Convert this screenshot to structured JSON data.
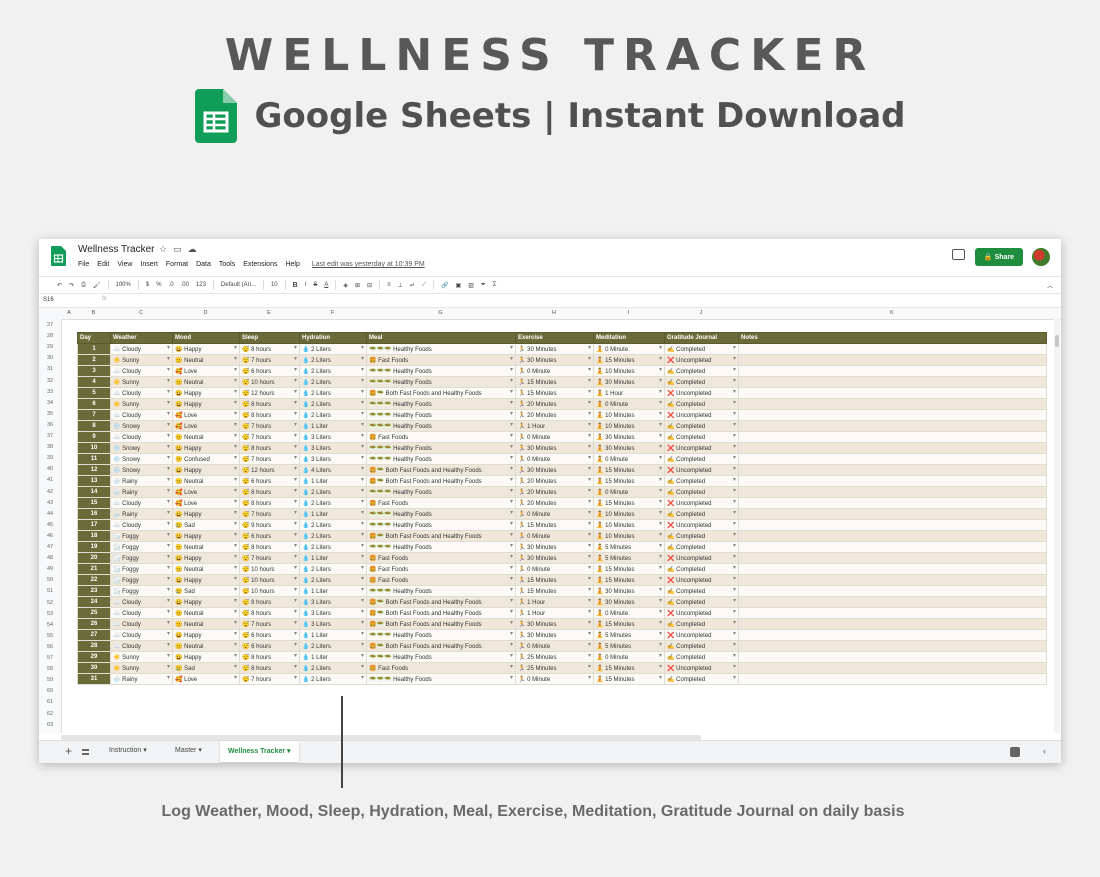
{
  "hero": {
    "title": "WELLNESS TRACKER",
    "subtitle": "Google Sheets | Instant Download"
  },
  "window": {
    "doc_title": "Wellness Tracker",
    "menu": [
      "File",
      "Edit",
      "View",
      "Insert",
      "Format",
      "Data",
      "Tools",
      "Extensions",
      "Help"
    ],
    "last_edit": "Last edit was yesterday at 10:39 PM",
    "share_label": "Share",
    "zoom": "100%",
    "font": "Default (Ari...",
    "font_size": "10",
    "cell_ref": "S16",
    "fx": "fx",
    "format_labels": [
      "$",
      "%",
      ".0",
      ".00",
      "123"
    ]
  },
  "column_letters": [
    "A",
    "B",
    "C",
    "D",
    "E",
    "F",
    "G",
    "H",
    "I",
    "J",
    "K"
  ],
  "row_numbers": [
    "27",
    "28",
    "29",
    "30",
    "31",
    "32",
    "33",
    "34",
    "35",
    "36",
    "37",
    "38",
    "39",
    "40",
    "41",
    "42",
    "43",
    "44",
    "45",
    "46",
    "47",
    "48",
    "49",
    "50",
    "51",
    "52",
    "53",
    "54",
    "55",
    "56",
    "57",
    "58",
    "59",
    "60",
    "61",
    "62",
    "63"
  ],
  "table": {
    "headers": [
      "Day",
      "Weather",
      "Mood",
      "Sleep",
      "Hydration",
      "Meal",
      "Exercise",
      "Meditation",
      "Gratitude Journal",
      "Notes"
    ],
    "rows": [
      [
        "1",
        "☁️ Cloudy",
        "😀 Happy",
        "😴 8 hours",
        "💧 2 Liters",
        "🥗🥗🥗 Healthy Foods",
        "🏃 30 Minutes",
        "🧘 0 Minute",
        "✍️ Completed"
      ],
      [
        "2",
        "☀️ Sunny",
        "😐 Neutral",
        "😴 7 hours",
        "💧 2 Liters",
        "🍔 Fast Foods",
        "🏃 30 Minutes",
        "🧘 15 Minutes",
        "❌ Uncompleted"
      ],
      [
        "3",
        "☁️ Cloudy",
        "🥰 Love",
        "😴 6 hours",
        "💧 2 Liters",
        "🥗🥗🥗 Healthy Foods",
        "🏃 0 Minute",
        "🧘 10 Minutes",
        "✍️ Completed"
      ],
      [
        "4",
        "☀️ Sunny",
        "😐 Neutral",
        "😴 10 hours",
        "💧 2 Liters",
        "🥗🥗🥗 Healthy Foods",
        "🏃 15 Minutes",
        "🧘 30 Minutes",
        "✍️ Completed"
      ],
      [
        "5",
        "☁️ Cloudy",
        "😀 Happy",
        "😴 12 hours",
        "💧 2 Liters",
        "🍔🥗 Both Fast Foods and Healthy Foods",
        "🏃 15 Minutes",
        "🧘 1 Hour",
        "❌ Uncompleted"
      ],
      [
        "6",
        "☀️ Sunny",
        "😀 Happy",
        "😴 8 hours",
        "💧 2 Liters",
        "🥗🥗🥗 Healthy Foods",
        "🏃 20 Minutes",
        "🧘 0 Minute",
        "✍️ Completed"
      ],
      [
        "7",
        "☁️ Cloudy",
        "🥰 Love",
        "😴 8 hours",
        "💧 2 Liters",
        "🥗🥗🥗 Healthy Foods",
        "🏃 20 Minutes",
        "🧘 10 Minutes",
        "❌ Uncompleted"
      ],
      [
        "8",
        "❄️ Snowy",
        "🥰 Love",
        "😴 7 hours",
        "💧 1 Liter",
        "🥗🥗🥗 Healthy Foods",
        "🏃 1 Hour",
        "🧘 10 Minutes",
        "✍️ Completed"
      ],
      [
        "9",
        "☁️ Cloudy",
        "😐 Neutral",
        "😴 7 hours",
        "💧 3 Liters",
        "🍔 Fast Foods",
        "🏃 0 Minute",
        "🧘 30 Minutes",
        "✍️ Completed"
      ],
      [
        "10",
        "❄️ Snowy",
        "😀 Happy",
        "😴 8 hours",
        "💧 3 Liters",
        "🥗🥗🥗 Healthy Foods",
        "🏃 30 Minutes",
        "🧘 30 Minutes",
        "❌ Uncompleted"
      ],
      [
        "11",
        "❄️ Snowy",
        "😕 Confused",
        "😴 7 hours",
        "💧 3 Liters",
        "🥗🥗🥗 Healthy Foods",
        "🏃 0 Minute",
        "🧘 0 Minute",
        "✍️ Completed"
      ],
      [
        "12",
        "❄️ Snowy",
        "😀 Happy",
        "😴 12 hours",
        "💧 4 Liters",
        "🍔🥗 Both Fast Foods and Healthy Foods",
        "🏃 30 Minutes",
        "🧘 15 Minutes",
        "❌ Uncompleted"
      ],
      [
        "13",
        "🌧️ Rainy",
        "😐 Neutral",
        "😴 6 hours",
        "💧 1 Liter",
        "🍔🥗 Both Fast Foods and Healthy Foods",
        "🏃 20 Minutes",
        "🧘 15 Minutes",
        "✍️ Completed"
      ],
      [
        "14",
        "🌧️ Rainy",
        "🥰 Love",
        "😴 8 hours",
        "💧 2 Liters",
        "🥗🥗🥗 Healthy Foods",
        "🏃 20 Minutes",
        "🧘 0 Minute",
        "✍️ Completed"
      ],
      [
        "15",
        "☁️ Cloudy",
        "🥰 Love",
        "😴 8 hours",
        "💧 2 Liters",
        "🍔 Fast Foods",
        "🏃 20 Minutes",
        "🧘 15 Minutes",
        "❌ Uncompleted"
      ],
      [
        "16",
        "🌧️ Rainy",
        "😀 Happy",
        "😴 7 hours",
        "💧 1 Liter",
        "🥗🥗🥗 Healthy Foods",
        "🏃 0 Minute",
        "🧘 10 Minutes",
        "✍️ Completed"
      ],
      [
        "17",
        "☁️ Cloudy",
        "😢 Sad",
        "😴 9 hours",
        "💧 2 Liters",
        "🥗🥗🥗 Healthy Foods",
        "🏃 15 Minutes",
        "🧘 10 Minutes",
        "❌ Uncompleted"
      ],
      [
        "18",
        "🌫️ Foggy",
        "😀 Happy",
        "😴 6 hours",
        "💧 2 Liters",
        "🍔🥗 Both Fast Foods and Healthy Foods",
        "🏃 0 Minute",
        "🧘 10 Minutes",
        "✍️ Completed"
      ],
      [
        "19",
        "🌫️ Foggy",
        "😐 Neutral",
        "😴 8 hours",
        "💧 2 Liters",
        "🥗🥗🥗 Healthy Foods",
        "🏃 30 Minutes",
        "🧘 5 Minutes",
        "✍️ Completed"
      ],
      [
        "20",
        "🌫️ Foggy",
        "😀 Happy",
        "😴 7 hours",
        "💧 1 Liter",
        "🍔 Fast Foods",
        "🏃 30 Minutes",
        "🧘 5 Minutes",
        "❌ Uncompleted"
      ],
      [
        "21",
        "🌫️ Foggy",
        "😐 Neutral",
        "😴 10 hours",
        "💧 2 Liters",
        "🍔 Fast Foods",
        "🏃 0 Minute",
        "🧘 15 Minutes",
        "✍️ Completed"
      ],
      [
        "22",
        "🌫️ Foggy",
        "😀 Happy",
        "😴 10 hours",
        "💧 2 Liters",
        "🍔 Fast Foods",
        "🏃 15 Minutes",
        "🧘 15 Minutes",
        "❌ Uncompleted"
      ],
      [
        "23",
        "🌫️ Foggy",
        "😢 Sad",
        "😴 10 hours",
        "💧 1 Liter",
        "🥗🥗🥗 Healthy Foods",
        "🏃 15 Minutes",
        "🧘 30 Minutes",
        "✍️ Completed"
      ],
      [
        "24",
        "☁️ Cloudy",
        "😀 Happy",
        "😴 8 hours",
        "💧 3 Liters",
        "🍔🥗 Both Fast Foods and Healthy Foods",
        "🏃 1 Hour",
        "🧘 30 Minutes",
        "✍️ Completed"
      ],
      [
        "25",
        "☁️ Cloudy",
        "😐 Neutral",
        "😴 8 hours",
        "💧 3 Liters",
        "🍔🥗 Both Fast Foods and Healthy Foods",
        "🏃 1 Hour",
        "🧘 0 Minute",
        "❌ Uncompleted"
      ],
      [
        "26",
        "☁️ Cloudy",
        "😐 Neutral",
        "😴 7 hours",
        "💧 3 Liters",
        "🍔🥗 Both Fast Foods and Healthy Foods",
        "🏃 30 Minutes",
        "🧘 15 Minutes",
        "✍️ Completed"
      ],
      [
        "27",
        "☁️ Cloudy",
        "😀 Happy",
        "😴 6 hours",
        "💧 1 Liter",
        "🥗🥗🥗 Healthy Foods",
        "🏃 30 Minutes",
        "🧘 5 Minutes",
        "❌ Uncompleted"
      ],
      [
        "28",
        "☁️ Cloudy",
        "😐 Neutral",
        "😴 6 hours",
        "💧 2 Liters",
        "🍔🥗 Both Fast Foods and Healthy Foods",
        "🏃 0 Minute",
        "🧘 5 Minutes",
        "✍️ Completed"
      ],
      [
        "29",
        "☀️ Sunny",
        "😀 Happy",
        "😴 8 hours",
        "💧 1 Liter",
        "🥗🥗🥗 Healthy Foods",
        "🏃 25 Minutes",
        "🧘 0 Minute",
        "✍️ Completed"
      ],
      [
        "30",
        "☀️ Sunny",
        "😢 Sad",
        "😴 8 hours",
        "💧 2 Liters",
        "🍔 Fast Foods",
        "🏃 25 Minutes",
        "🧘 15 Minutes",
        "❌ Uncompleted"
      ],
      [
        "31",
        "🌧️ Rainy",
        "🥰 Love",
        "😴 7 hours",
        "💧 2 Liters",
        "🥗🥗🥗 Healthy Foods",
        "🏃 0 Minute",
        "🧘 15 Minutes",
        "✍️ Completed"
      ]
    ]
  },
  "tabs": [
    "Instruction",
    "Master",
    "Wellness Tracker"
  ],
  "active_tab": "Wellness Tracker",
  "caption": "Log Weather, Mood, Sleep, Hydration, Meal, Exercise, Meditation, Gratitude Journal on daily basis",
  "colors": {
    "header_bg": "#6b6b3a",
    "stripe": "#efe8da",
    "share": "#1e8e3e",
    "sheets_green": "#0f9d58"
  }
}
